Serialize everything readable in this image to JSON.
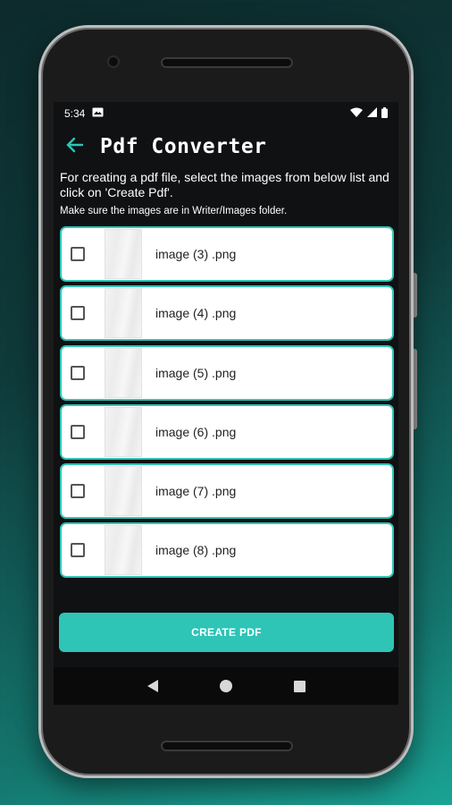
{
  "status_bar": {
    "time": "5:34",
    "notification_icon": "image-notification-icon",
    "icons": [
      "wifi-icon",
      "signal-icon",
      "battery-icon"
    ]
  },
  "app_bar": {
    "back_icon": "arrow-left-icon",
    "title": "Pdf Converter"
  },
  "instructions": {
    "main": "For creating a pdf file, select the images from below list and click on 'Create Pdf'.",
    "note": "Make sure the images are in Writer/Images folder."
  },
  "images": [
    {
      "filename": "image (3) .png",
      "checked": false
    },
    {
      "filename": "image (4) .png",
      "checked": false
    },
    {
      "filename": "image (5) .png",
      "checked": false
    },
    {
      "filename": "image (6) .png",
      "checked": false
    },
    {
      "filename": "image (7) .png",
      "checked": false
    },
    {
      "filename": "image (8) .png",
      "checked": false
    }
  ],
  "create_button": {
    "label": "CREATE PDF"
  },
  "nav_bar": {
    "icons": [
      "back-nav-icon",
      "home-nav-icon",
      "recents-nav-icon"
    ]
  },
  "colors": {
    "accent": "#2ec4b6",
    "screen_bg": "#0f1113",
    "card_bg": "#ffffff"
  }
}
